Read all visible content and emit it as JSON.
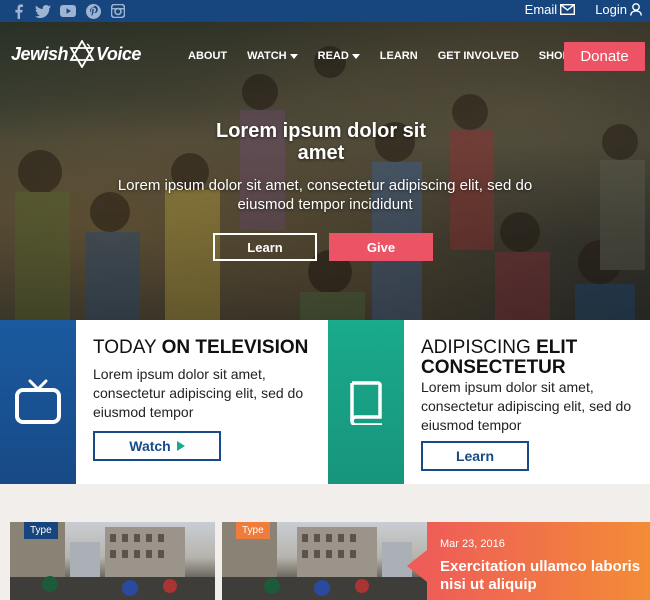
{
  "topbar": {
    "social_icons": [
      "facebook-icon",
      "twitter-icon",
      "youtube-icon",
      "pinterest-icon",
      "instagram-icon"
    ],
    "email_label": "Email",
    "login_label": "Login"
  },
  "header": {
    "logo_text_left": "Jewish",
    "logo_text_right": "Voice",
    "nav": [
      {
        "label": "ABOUT",
        "dropdown": false
      },
      {
        "label": "WATCH",
        "dropdown": true
      },
      {
        "label": "READ",
        "dropdown": true
      },
      {
        "label": "LEARN",
        "dropdown": false
      },
      {
        "label": "GET INVOLVED",
        "dropdown": false
      },
      {
        "label": "SHOP",
        "dropdown": false
      }
    ],
    "donate_label": "Donate"
  },
  "hero": {
    "title": "Lorem ipsum dolor sit amet",
    "subtitle": "Lorem ipsum dolor sit amet, consectetur adipiscing elit, sed do eiusmod tempor incididunt",
    "learn_label": "Learn",
    "give_label": "Give"
  },
  "features": [
    {
      "title_light": "TODAY ",
      "title_bold": "ON TELEVISION",
      "text": "Lorem ipsum dolor sit amet, consectetur adipiscing elit, sed do eiusmod tempor",
      "button_label": "Watch",
      "icon": "tv-icon"
    },
    {
      "title_light": "ADIPISCING ",
      "title_bold": "ELIT CONSECTETUR",
      "text": "Lorem ipsum dolor sit amet, consectetur adipiscing elit, sed do eiusmod tempor",
      "button_label": "Learn",
      "icon": "book-icon"
    }
  ],
  "cards": [
    {
      "badge": "Type"
    },
    {
      "badge": "Type"
    }
  ],
  "promo": {
    "date": "Mar 23, 2016",
    "title": "Exercitation ullamco laboris nisi ut aliquip"
  },
  "colors": {
    "navy": "#17467e",
    "coral": "#ec5466",
    "teal": "#1aaa8c",
    "orange": "#f38c37"
  }
}
